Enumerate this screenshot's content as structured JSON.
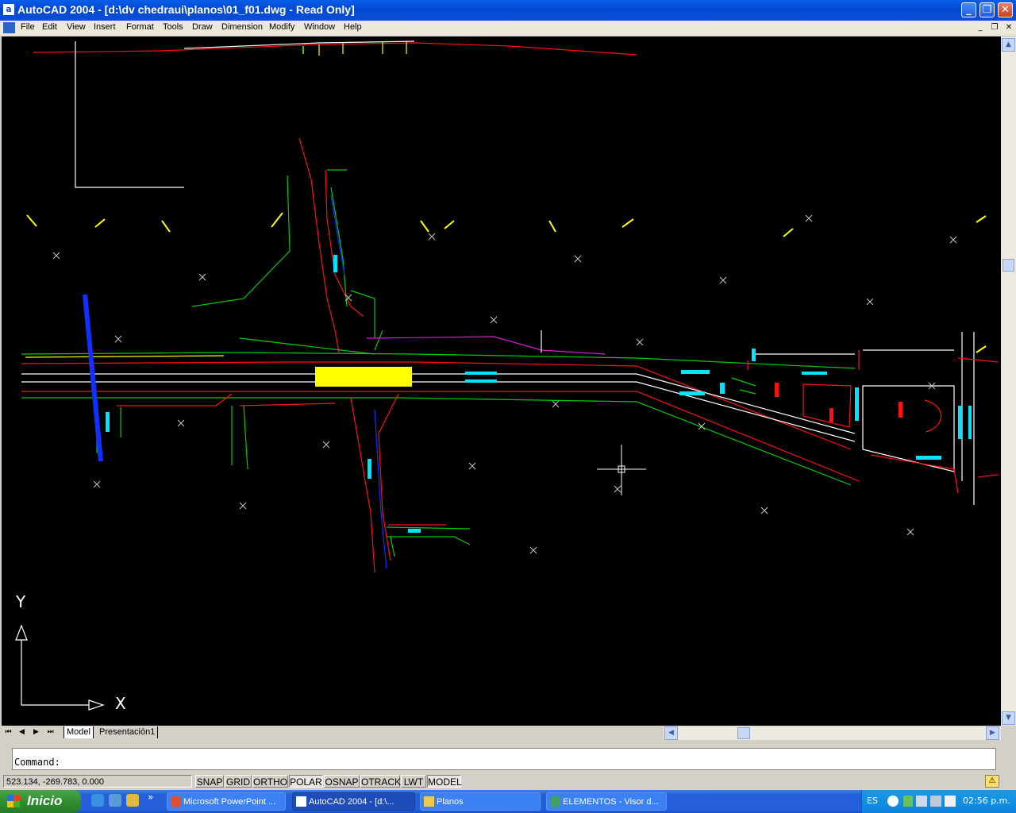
{
  "window": {
    "title": "AutoCAD 2004 - [d:\\dv chedraui\\planos\\01_f01.dwg - Read Only]",
    "app_icon_letter": "a",
    "minimize_glyph": "_",
    "restore_glyph": "❐",
    "close_glyph": "✕"
  },
  "menu": {
    "items": [
      "File",
      "Edit",
      "View",
      "Insert",
      "Format",
      "Tools",
      "Draw",
      "Dimension",
      "Modify",
      "Window",
      "Help"
    ],
    "doc_controls": [
      "_",
      "❐",
      "✕"
    ]
  },
  "ucs_icon": {
    "y_label": "Y",
    "x_label": "X"
  },
  "layout_tabs": {
    "nav": [
      "⏮",
      "◀",
      "▶",
      "⏭"
    ],
    "tabs": [
      {
        "label": "Model",
        "active": true
      },
      {
        "label": "Presentación1",
        "active": false
      }
    ]
  },
  "command": {
    "prompt": "Command:"
  },
  "status": {
    "coordinates": "523.134, -269.783, 0.000",
    "toggles": [
      {
        "label": "SNAP",
        "on": false
      },
      {
        "label": "GRID",
        "on": false
      },
      {
        "label": "ORTHO",
        "on": false
      },
      {
        "label": "POLAR",
        "on": true
      },
      {
        "label": "OSNAP",
        "on": false
      },
      {
        "label": "OTRACK",
        "on": false
      },
      {
        "label": "LWT",
        "on": false
      },
      {
        "label": "MODEL",
        "on": true
      }
    ]
  },
  "taskbar": {
    "start_label": "Inicio",
    "chevron": "»",
    "tasks": [
      {
        "label": "Microsoft PowerPoint ...",
        "icon": "powerpoint-icon",
        "active": false
      },
      {
        "label": "AutoCAD 2004 - [d:\\...",
        "icon": "autocad-icon",
        "active": true
      },
      {
        "label": "Planos",
        "icon": "folder-icon",
        "active": false
      },
      {
        "label": "ELEMENTOS - Visor d...",
        "icon": "image-viewer-icon",
        "active": false
      }
    ],
    "tray": {
      "language": "ES",
      "clock": "02:56 p.m."
    }
  },
  "colors": {
    "canvas": "#000000",
    "red": "#ff1010",
    "green": "#00cc00",
    "yellow": "#ffff00",
    "cyan": "#00e5ff",
    "blue": "#1030ff",
    "white": "#ffffff",
    "magenta": "#d020d0"
  }
}
